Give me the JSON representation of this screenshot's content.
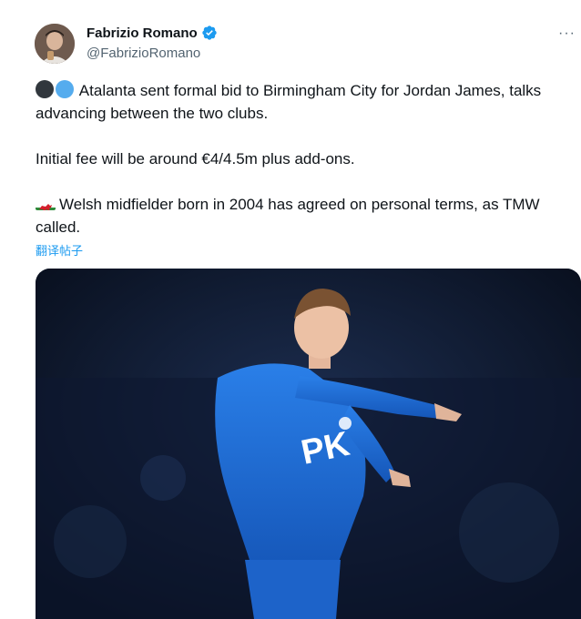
{
  "author": {
    "display_name": "Fabrizio Romano",
    "handle": "@FabrizioRomano",
    "verified_icon": "verified-badge-icon"
  },
  "menu": {
    "more_label": "···"
  },
  "tweet": {
    "line1": "Atalanta sent formal bid to Birmingham City for Jordan James, talks advancing between the two clubs.",
    "line2": "Initial fee will be around €4/4.5m plus add-ons.",
    "line3": "Welsh midfielder born in 2004 has agreed on personal terms, as TMW called.",
    "translate_label": "翻译帖子"
  },
  "media": {
    "shirt_sponsor": "PK",
    "shirt_color": "#1e6fd9"
  },
  "colors": {
    "link": "#1d9bf0",
    "secondary_text": "#536471",
    "verified": "#1d9bf0"
  }
}
